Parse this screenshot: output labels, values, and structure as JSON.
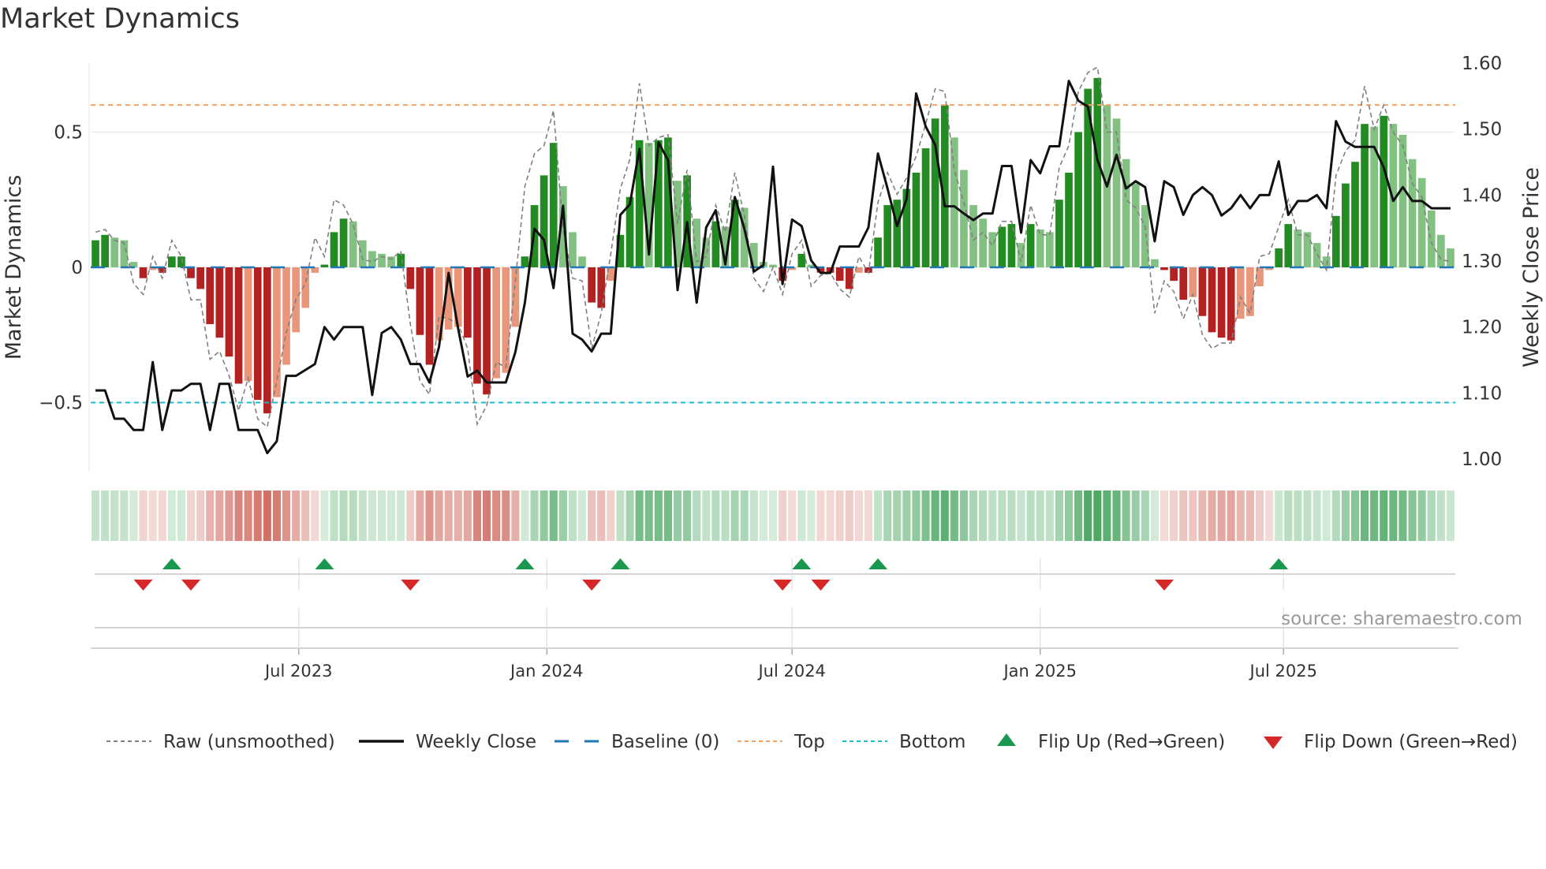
{
  "title": "Market Dynamics",
  "source": "source: sharemaestro.com",
  "chart_data": {
    "type": "bar",
    "title": "Market Dynamics",
    "ylabel": "Market Dynamics",
    "y2label": "Weekly Close Price",
    "ylim": [
      -0.755,
      0.755
    ],
    "y2lim": [
      0.981,
      1.6
    ],
    "yticks": [
      {
        "value": 0.5,
        "label": "0.5"
      },
      {
        "value": 0,
        "label": "0"
      },
      {
        "value": -0.5,
        "label": "−0.5"
      }
    ],
    "y2ticks": [
      {
        "value": 1.0,
        "label": "1.00"
      },
      {
        "value": 1.1,
        "label": "1.10"
      },
      {
        "value": 1.2,
        "label": "1.20"
      },
      {
        "value": 1.3,
        "label": "1.30"
      },
      {
        "value": 1.4,
        "label": "1.40"
      },
      {
        "value": 1.5,
        "label": "1.50"
      },
      {
        "value": 1.6,
        "label": "1.60"
      }
    ],
    "xticks": [
      {
        "label": "Jul 2023",
        "index": 21.3
      },
      {
        "label": "Jan 2024",
        "index": 47.3
      },
      {
        "label": "Jul 2024",
        "index": 73.0
      },
      {
        "label": "Jan 2025",
        "index": 99.0
      },
      {
        "label": "Jul 2025",
        "index": 124.5
      }
    ],
    "thresholds": {
      "top": 0.6,
      "bottom": -0.5,
      "baseline": 0
    },
    "momentum": [
      0.1,
      0.12,
      0.11,
      0.1,
      0.02,
      -0.04,
      -0.01,
      -0.02,
      0.04,
      0.04,
      -0.04,
      -0.08,
      -0.21,
      -0.26,
      -0.33,
      -0.43,
      -0.42,
      -0.49,
      -0.54,
      -0.48,
      -0.36,
      -0.24,
      -0.15,
      -0.02,
      0.01,
      0.13,
      0.18,
      0.17,
      0.1,
      0.06,
      0.05,
      0.04,
      0.05,
      -0.08,
      -0.25,
      -0.36,
      -0.27,
      -0.23,
      -0.22,
      -0.26,
      -0.43,
      -0.47,
      -0.41,
      -0.39,
      -0.22,
      0.04,
      0.23,
      0.34,
      0.46,
      0.3,
      0.13,
      0.04,
      -0.13,
      -0.15,
      -0.05,
      0.12,
      0.26,
      0.47,
      0.46,
      0.47,
      0.48,
      0.32,
      0.34,
      0.18,
      0.11,
      0.17,
      0.15,
      0.25,
      0.22,
      0.09,
      0.02,
      0.01,
      -0.05,
      -0.01,
      0.05,
      0.01,
      -0.02,
      -0.02,
      -0.05,
      -0.08,
      -0.02,
      -0.02,
      0.11,
      0.23,
      0.25,
      0.29,
      0.35,
      0.44,
      0.55,
      0.6,
      0.48,
      0.36,
      0.23,
      0.18,
      0.13,
      0.15,
      0.16,
      0.09,
      0.16,
      0.14,
      0.13,
      0.25,
      0.35,
      0.5,
      0.66,
      0.7,
      0.6,
      0.55,
      0.4,
      0.31,
      0.23,
      0.03,
      -0.01,
      -0.05,
      -0.12,
      -0.11,
      -0.18,
      -0.24,
      -0.26,
      -0.27,
      -0.19,
      -0.18,
      -0.07,
      -0.01,
      0.07,
      0.16,
      0.14,
      0.13,
      0.09,
      0.04,
      0.19,
      0.31,
      0.39,
      0.53,
      0.52,
      0.56,
      0.53,
      0.49,
      0.4,
      0.33,
      0.21,
      0.12,
      0.07
    ],
    "raw": [
      0.13,
      0.14,
      0.1,
      0.09,
      -0.06,
      -0.1,
      0.04,
      -0.04,
      0.1,
      0.04,
      -0.12,
      -0.12,
      -0.34,
      -0.31,
      -0.4,
      -0.53,
      -0.41,
      -0.56,
      -0.59,
      -0.42,
      -0.24,
      -0.12,
      -0.06,
      0.11,
      0.04,
      0.25,
      0.23,
      0.16,
      0.03,
      0.02,
      0.04,
      0.03,
      0.06,
      -0.21,
      -0.42,
      -0.47,
      -0.18,
      -0.19,
      -0.21,
      -0.3,
      -0.58,
      -0.51,
      -0.35,
      -0.37,
      -0.05,
      0.3,
      0.42,
      0.45,
      0.58,
      0.14,
      -0.04,
      -0.05,
      -0.3,
      -0.17,
      0.05,
      0.29,
      0.4,
      0.68,
      0.45,
      0.48,
      0.49,
      0.16,
      0.36,
      0.02,
      0.04,
      0.23,
      0.13,
      0.35,
      0.19,
      -0.04,
      -0.09,
      0.0,
      -0.1,
      0.05,
      0.1,
      -0.07,
      -0.03,
      -0.02,
      -0.08,
      -0.11,
      0.04,
      -0.02,
      0.24,
      0.35,
      0.27,
      0.33,
      0.41,
      0.53,
      0.66,
      0.65,
      0.36,
      0.24,
      0.1,
      0.13,
      0.08,
      0.17,
      0.17,
      0.02,
      0.23,
      0.12,
      0.12,
      0.37,
      0.45,
      0.65,
      0.72,
      0.74,
      0.5,
      0.5,
      0.25,
      0.22,
      0.15,
      -0.17,
      -0.05,
      -0.09,
      -0.19,
      -0.1,
      -0.25,
      -0.3,
      -0.28,
      -0.28,
      -0.11,
      -0.17,
      0.04,
      0.05,
      0.15,
      0.25,
      0.12,
      0.12,
      0.05,
      -0.01,
      0.34,
      0.43,
      0.47,
      0.67,
      0.51,
      0.6,
      0.5,
      0.45,
      0.31,
      0.26,
      0.09,
      0.03,
      0.02
    ],
    "close": [
      1.104,
      1.104,
      1.061,
      1.061,
      1.044,
      1.044,
      1.147,
      1.044,
      1.104,
      1.104,
      1.114,
      1.114,
      1.044,
      1.114,
      1.114,
      1.044,
      1.044,
      1.044,
      1.009,
      1.027,
      1.126,
      1.126,
      1.135,
      1.144,
      1.2,
      1.181,
      1.2,
      1.2,
      1.2,
      1.097,
      1.191,
      1.2,
      1.181,
      1.144,
      1.144,
      1.116,
      1.17,
      1.282,
      1.198,
      1.125,
      1.134,
      1.116,
      1.116,
      1.116,
      1.162,
      1.237,
      1.349,
      1.332,
      1.259,
      1.384,
      1.19,
      1.181,
      1.163,
      1.19,
      1.19,
      1.37,
      1.386,
      1.47,
      1.31,
      1.48,
      1.453,
      1.256,
      1.359,
      1.237,
      1.351,
      1.377,
      1.295,
      1.397,
      1.349,
      1.284,
      1.294,
      1.443,
      1.265,
      1.363,
      1.353,
      1.301,
      1.282,
      1.282,
      1.322,
      1.322,
      1.322,
      1.351,
      1.463,
      1.41,
      1.353,
      1.394,
      1.554,
      1.504,
      1.476,
      1.383,
      1.383,
      1.372,
      1.362,
      1.372,
      1.372,
      1.444,
      1.444,
      1.343,
      1.453,
      1.433,
      1.474,
      1.474,
      1.573,
      1.543,
      1.534,
      1.453,
      1.413,
      1.461,
      1.41,
      1.421,
      1.412,
      1.33,
      1.421,
      1.412,
      1.37,
      1.4,
      1.412,
      1.4,
      1.369,
      1.38,
      1.4,
      1.38,
      1.4,
      1.4,
      1.451,
      1.37,
      1.391,
      1.391,
      1.4,
      1.38,
      1.512,
      1.481,
      1.473,
      1.473,
      1.473,
      1.442,
      1.391,
      1.412,
      1.391,
      1.391,
      1.38,
      1.38,
      1.38
    ],
    "flip_up": [
      8,
      24,
      45,
      55,
      74,
      82,
      124
    ],
    "flip_down": [
      5,
      10,
      33,
      52,
      72,
      76,
      112
    ],
    "colors": {
      "up_strong": "#228b22",
      "up_weak": "#82c182",
      "down_strong": "#b22222",
      "down_weak": "#e9967a",
      "close": "#111111",
      "raw": "#808080",
      "baseline": "#1f77b4",
      "top": "#f4a460",
      "bottom": "#17becf",
      "flip_up": "#1a9850",
      "flip_down": "#d62728"
    },
    "legend": {
      "placement": "bottom",
      "items": [
        {
          "key": "raw",
          "label": "Raw (unsmoothed)"
        },
        {
          "key": "close",
          "label": "Weekly Close"
        },
        {
          "key": "baseline",
          "label": "Baseline (0)"
        },
        {
          "key": "top",
          "label": "Top"
        },
        {
          "key": "bottom",
          "label": "Bottom"
        },
        {
          "key": "flip_up",
          "label": "Flip Up (Red→Green)"
        },
        {
          "key": "flip_down",
          "label": "Flip Down (Green→Red)"
        }
      ]
    }
  }
}
